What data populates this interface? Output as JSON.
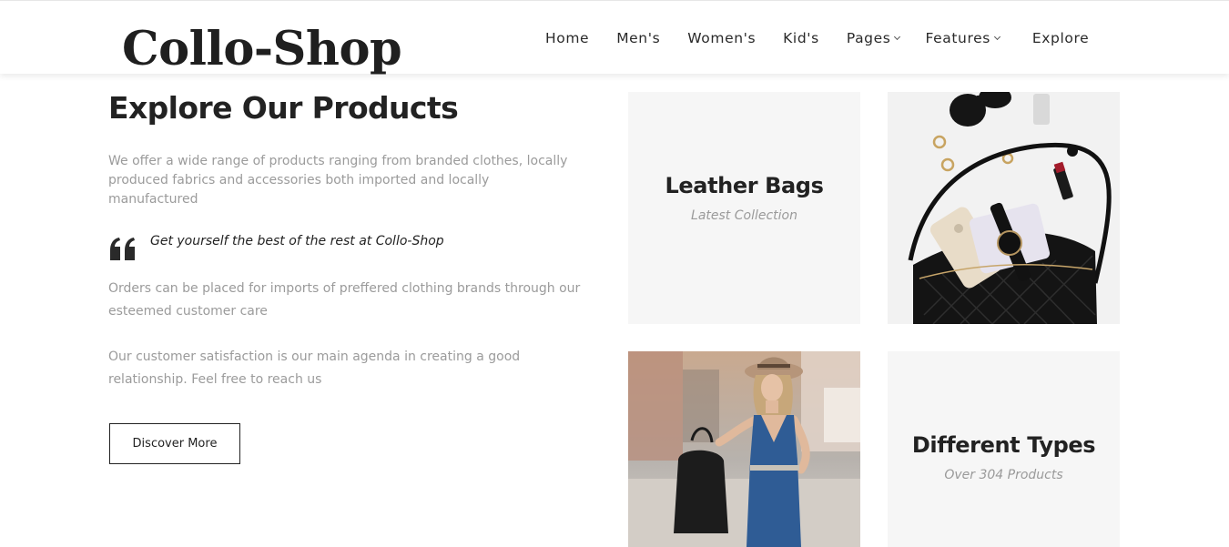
{
  "header": {
    "logo": "Collo-Shop",
    "nav": [
      {
        "label": "Home",
        "has_dropdown": false
      },
      {
        "label": "Men's",
        "has_dropdown": false
      },
      {
        "label": "Women's",
        "has_dropdown": false
      },
      {
        "label": "Kid's",
        "has_dropdown": false
      },
      {
        "label": "Pages",
        "has_dropdown": true
      },
      {
        "label": "Features",
        "has_dropdown": true
      },
      {
        "label": "Explore",
        "has_dropdown": false
      }
    ]
  },
  "main": {
    "title": "Explore Our Products",
    "intro": "We offer a wide range of products ranging from branded clothes, locally produced fabrics and accessories both imported and locally manufactured",
    "quote": "Get yourself the best of the rest at Collo-Shop",
    "paragraph_1": "Orders can be placed for imports of preffered clothing brands through our esteemed customer care",
    "paragraph_2": "Our customer satisfaction is our main agenda in creating a good relationship. Feel free to reach us",
    "button_label": "Discover More"
  },
  "tiles": {
    "leather": {
      "title": "Leather Bags",
      "subtitle": "Latest Collection"
    },
    "types": {
      "title": "Different Types",
      "subtitle": "Over 304 Products"
    }
  },
  "icons": {
    "quote": "quote-icon",
    "chevron": "chevron-down-icon"
  },
  "colors": {
    "text_dark": "#222222",
    "text_muted": "#9b9b9b",
    "tile_bg": "#f6f6f6"
  }
}
